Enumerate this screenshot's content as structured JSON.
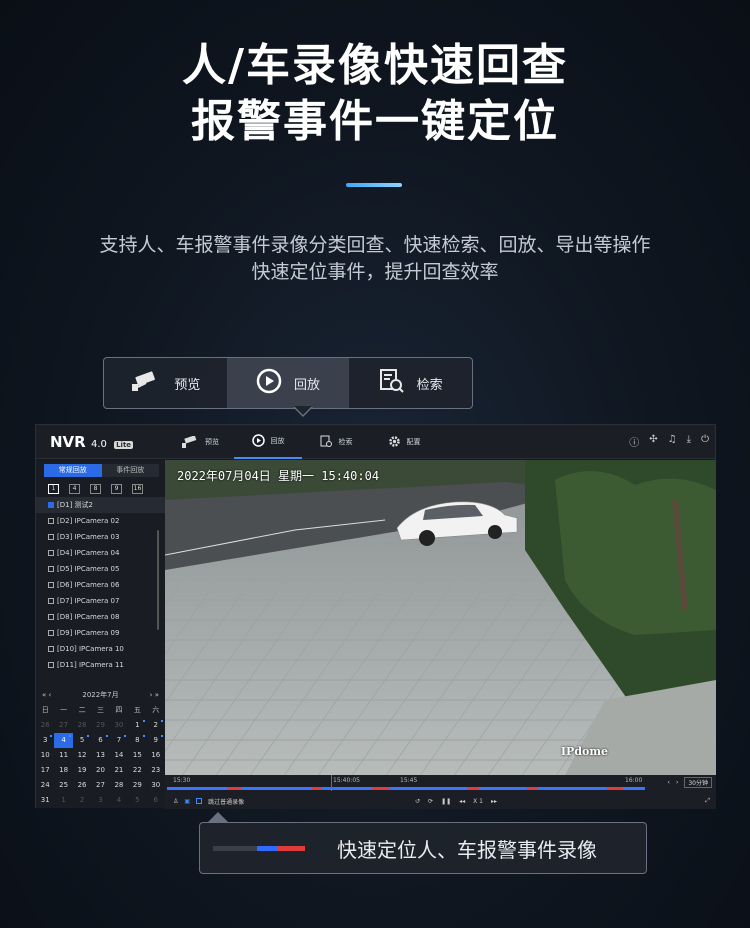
{
  "headline": {
    "line1": "人/车录像快速回查",
    "line2": "报警事件一键定位"
  },
  "description": {
    "line1": "支持人、车报警事件录像分类回查、快速检索、回放、导出等操作",
    "line2": "快速定位事件，提升回查效率"
  },
  "callout_top": {
    "items": [
      {
        "label": "预览",
        "icon": "camera-icon"
      },
      {
        "label": "回放",
        "icon": "playback-icon"
      },
      {
        "label": "检索",
        "icon": "search-doc-icon"
      }
    ],
    "active": "回放"
  },
  "app": {
    "logo": {
      "name": "NVR",
      "version": "4.0",
      "edition": "Lite"
    },
    "nav": [
      {
        "label": "预览",
        "icon": "camera-icon"
      },
      {
        "label": "回放",
        "icon": "playback-icon"
      },
      {
        "label": "检索",
        "icon": "search-doc-icon"
      },
      {
        "label": "配置",
        "icon": "gear-icon"
      }
    ],
    "active_nav": "回放",
    "sidebar": {
      "tabs": [
        "常规回放",
        "事件回放"
      ],
      "active_tab": "常规回放",
      "layouts": [
        "1",
        "4",
        "8",
        "9",
        "16"
      ],
      "cameras": [
        "[D1] 测试2",
        "[D2] IPCamera 02",
        "[D3] IPCamera 03",
        "[D4] IPCamera 04",
        "[D5] IPCamera 05",
        "[D6] IPCamera 06",
        "[D7] IPCamera 07",
        "[D8] IPCamera 08",
        "[D9] IPCamera 09",
        "[D10] IPCamera 10",
        "[D11] IPCamera 11"
      ],
      "selected_camera": "[D1] 测试2",
      "calendar": {
        "title": "2022年7月",
        "prev_year": "«",
        "prev_month": "‹",
        "next_month": "›",
        "next_year": "»",
        "weekdays": [
          "日",
          "一",
          "二",
          "三",
          "四",
          "五",
          "六"
        ],
        "days": [
          "26",
          "27",
          "28",
          "29",
          "30",
          "1",
          "2",
          "3",
          "4",
          "5",
          "6",
          "7",
          "8",
          "9",
          "10",
          "11",
          "12",
          "13",
          "14",
          "15",
          "16",
          "17",
          "18",
          "19",
          "20",
          "21",
          "22",
          "23",
          "24",
          "25",
          "26",
          "27",
          "28",
          "29",
          "30",
          "31",
          "1",
          "2",
          "3",
          "4",
          "5",
          "6"
        ],
        "selected_day": "4"
      }
    },
    "video": {
      "osd": "2022年07月04日  星期一  15:40:04",
      "brand": "IPdome"
    },
    "timeline": {
      "labels": [
        "15:30",
        "15:40:05",
        "15:45",
        "16:00"
      ],
      "span": "30分钟",
      "skip_label": "跳过普通录像",
      "speed": "X 1",
      "prev": "‹",
      "next": "›"
    }
  },
  "callout_bottom": {
    "text": "快速定位人、车报警事件录像"
  }
}
